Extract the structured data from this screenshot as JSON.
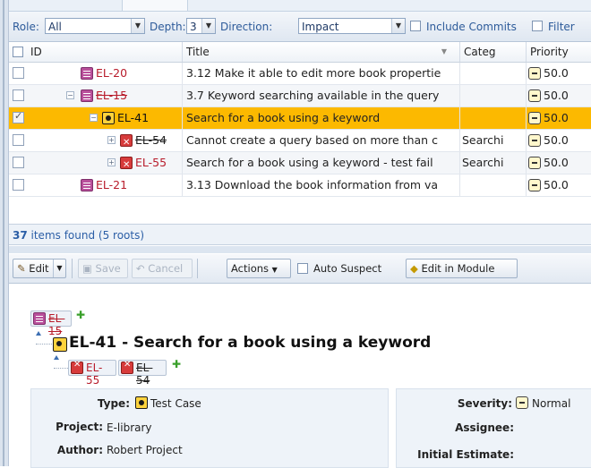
{
  "filterbar": {
    "role_label": "Role:",
    "role_value": "All",
    "depth_label": "Depth:",
    "depth_value": "3",
    "direction_label": "Direction:",
    "direction_value": "Impact",
    "include_commits_label": "Include Commits",
    "filter_label": "Filter"
  },
  "grid": {
    "columns": [
      "ID",
      "Title",
      "Categ",
      "Priority"
    ],
    "rows": [
      {
        "id": "EL-20",
        "title": "3.12 Make it able to edit more book propertie",
        "category": "",
        "priority": "50.0"
      },
      {
        "id": "EL-15",
        "title": "3.7 Keyword searching available in the query",
        "category": "",
        "priority": "50.0"
      },
      {
        "id": "EL-41",
        "title": "Search for a book using a keyword",
        "category": "",
        "priority": "50.0"
      },
      {
        "id": "EL-54",
        "title": "Cannot create a query based on more than c",
        "category": "Searchi",
        "priority": "50.0"
      },
      {
        "id": "EL-55",
        "title": "Search for a book using a keyword - test fail",
        "category": "Searchi",
        "priority": "50.0"
      },
      {
        "id": "EL-21",
        "title": "3.13 Download the book information from va",
        "category": "",
        "priority": "50.0"
      }
    ]
  },
  "status": {
    "count": "37",
    "text": " items found (5 roots)"
  },
  "toolbar": {
    "edit_label": "Edit",
    "save_label": "Save",
    "cancel_label": "Cancel",
    "actions_label": "Actions",
    "auto_suspect_label": "Auto Suspect",
    "edit_in_module_label": "Edit in Module"
  },
  "detail": {
    "parent_id": "EL-15",
    "title": "EL-41 - Search for a book using a keyword",
    "child_ids": [
      "EL-55",
      "EL-54"
    ],
    "type_label": "Type:",
    "type_value": "Test Case",
    "project_label": "Project:",
    "project_value": "E-library",
    "author_label": "Author:",
    "author_value": "Robert Project",
    "severity_label": "Severity:",
    "severity_value": "Normal",
    "assignee_label": "Assignee:",
    "assignee_value": "",
    "estimate_label": "Initial Estimate:",
    "estimate_value": ""
  }
}
